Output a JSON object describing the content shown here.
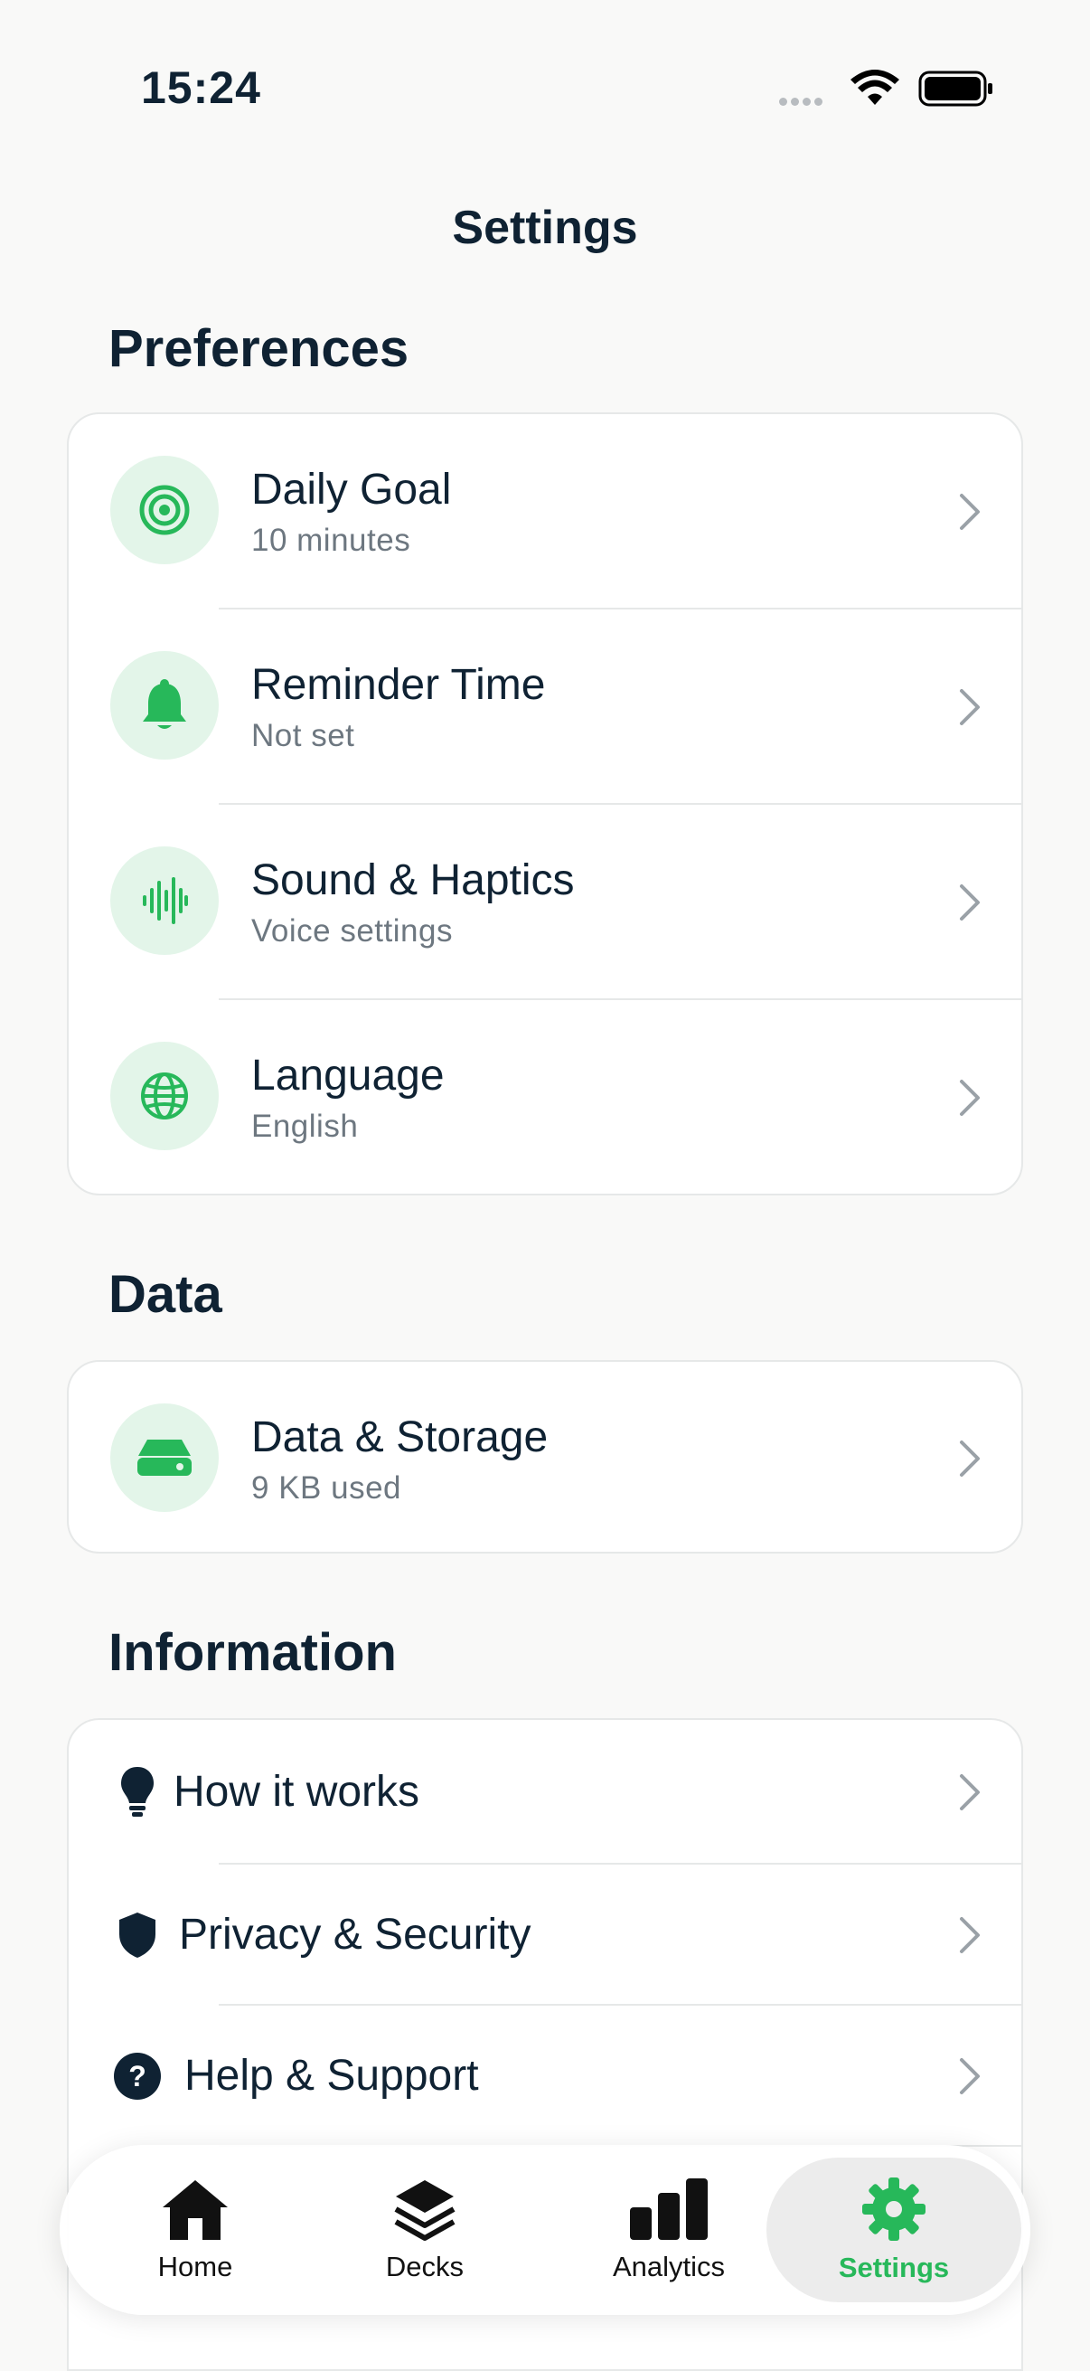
{
  "status": {
    "time": "15:24"
  },
  "header": {
    "title": "Settings"
  },
  "sections": {
    "preferences": "Preferences",
    "data": "Data",
    "information": "Information"
  },
  "preferences": [
    {
      "title": "Daily Goal",
      "subtitle": "10 minutes",
      "icon": "target-icon"
    },
    {
      "title": "Reminder Time",
      "subtitle": "Not set",
      "icon": "bell-icon"
    },
    {
      "title": "Sound & Haptics",
      "subtitle": "Voice settings",
      "icon": "waveform-icon"
    },
    {
      "title": "Language",
      "subtitle": "English",
      "icon": "globe-icon"
    }
  ],
  "data_items": [
    {
      "title": "Data & Storage",
      "subtitle": "9 KB used",
      "icon": "storage-drive-icon"
    }
  ],
  "information": [
    {
      "title": "How it works",
      "icon": "lightbulb-icon"
    },
    {
      "title": "Privacy & Security",
      "icon": "shield-icon"
    },
    {
      "title": "Help & Support",
      "icon": "question-circle-icon"
    }
  ],
  "tabbar": {
    "tabs": [
      {
        "label": "Home",
        "icon": "house-icon"
      },
      {
        "label": "Decks",
        "icon": "stack-icon"
      },
      {
        "label": "Analytics",
        "icon": "bar-chart-icon"
      },
      {
        "label": "Settings",
        "icon": "gear-icon"
      }
    ],
    "active": "Settings"
  },
  "colors": {
    "accent": "#27b85a",
    "icon_bg": "#e3f5e9",
    "text": "#0f2233",
    "subtext": "#6d7780",
    "background": "#f9f9f8"
  }
}
